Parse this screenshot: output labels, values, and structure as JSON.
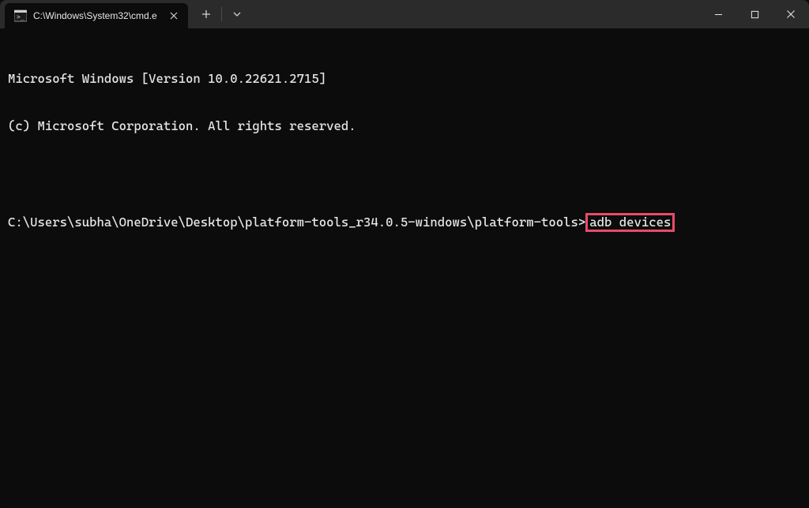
{
  "titlebar": {
    "tab_title": "C:\\Windows\\System32\\cmd.e",
    "tab_icon_name": "cmd-icon"
  },
  "terminal": {
    "line1": "Microsoft Windows [Version 10.0.22621.2715]",
    "line2": "(c) Microsoft Corporation. All rights reserved.",
    "prompt": "C:\\Users\\subha\\OneDrive\\Desktop\\platform-tools_r34.0.5-windows\\platform-tools>",
    "command": "adb devices"
  },
  "highlight_color": "#e84a6a"
}
